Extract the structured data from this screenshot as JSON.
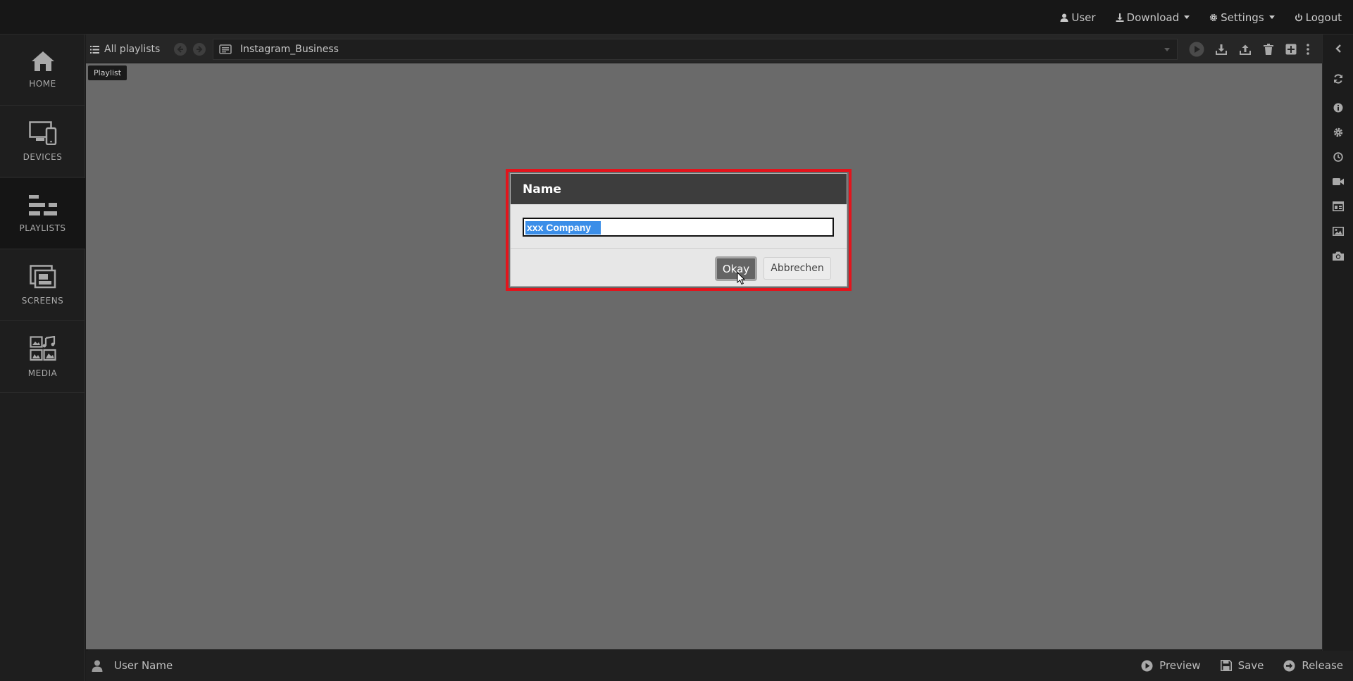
{
  "topnav": {
    "user": "User",
    "download": "Download",
    "settings": "Settings",
    "logout": "Logout"
  },
  "sidebar": {
    "items": [
      {
        "label": "HOME",
        "icon": "home-icon"
      },
      {
        "label": "DEVICES",
        "icon": "devices-icon"
      },
      {
        "label": "PLAYLISTS",
        "icon": "playlists-icon",
        "active": true
      },
      {
        "label": "SCREENS",
        "icon": "screens-icon"
      },
      {
        "label": "MEDIA",
        "icon": "media-icon"
      }
    ]
  },
  "toolbar": {
    "all_playlists": "All playlists",
    "playlist_value": "Instagram_Business",
    "icons": [
      "play-icon",
      "download-icon",
      "upload-icon",
      "trash-icon",
      "add-icon",
      "more-icon"
    ]
  },
  "workspace": {
    "tag": "Playlist"
  },
  "rightstrip": {
    "icons": [
      "collapse-icon",
      "refresh-icon",
      "info-icon",
      "gear-icon",
      "clock-icon",
      "video-icon",
      "layout-icon",
      "image-icon",
      "camera-icon"
    ]
  },
  "bottombar": {
    "user_name": "User Name",
    "preview": "Preview",
    "save": "Save",
    "release": "Release"
  },
  "dialog": {
    "title": "Name",
    "input_value": "xxx  Company",
    "okay": "Okay",
    "cancel": "Abbrechen"
  },
  "colors": {
    "highlight": "#e3141c",
    "selection": "#3b8ee8",
    "workspace": "#6a6a6a"
  }
}
